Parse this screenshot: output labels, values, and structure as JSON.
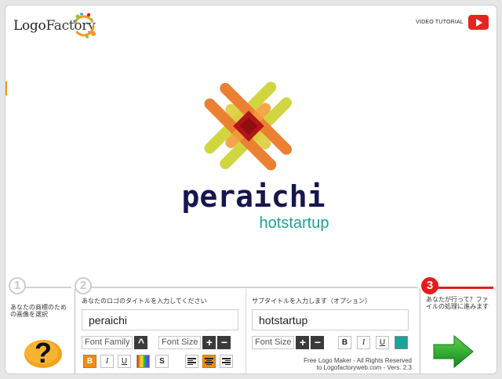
{
  "header": {
    "brand_word1": "Logo",
    "brand_word2": "Factory",
    "video_label": "VIDEO TUTORIAL"
  },
  "preview": {
    "title": "peraichi",
    "subtitle": "hotstartup",
    "title_color": "#17174d",
    "subtitle_color": "#1aa39a"
  },
  "steps": [
    {
      "number": "1",
      "label": "あなたの商標のための画像を選択"
    },
    {
      "number": "2",
      "title_label": "あなたのロゴのタイトルを入力してください",
      "subtitle_label": "サブタイトルを入力します（オプション）"
    },
    {
      "number": "3",
      "label": "あなたが行って？ファイルの処理に進みます"
    }
  ],
  "title_editor": {
    "value": "peraichi",
    "font_family_label": "Font Family",
    "font_size_label": "Font Size",
    "bold": "B",
    "italic": "I",
    "underline": "U",
    "shadow": "S"
  },
  "subtitle_editor": {
    "value": "hotstartup",
    "font_size_label": "Font Size",
    "bold": "B",
    "italic": "I",
    "underline": "U",
    "color": "#1aa39a"
  },
  "buttons": {
    "caret": "^",
    "plus": "+",
    "minus": "−"
  },
  "footer": {
    "line1": "Free Logo Maker - All Rights Reserved",
    "line2": "to Logofactoryweb.com - Vers. 2.3"
  },
  "colors": {
    "accent": "#f08c14",
    "step_active": "#e31d1d",
    "next_arrow": "#1fa22a"
  }
}
